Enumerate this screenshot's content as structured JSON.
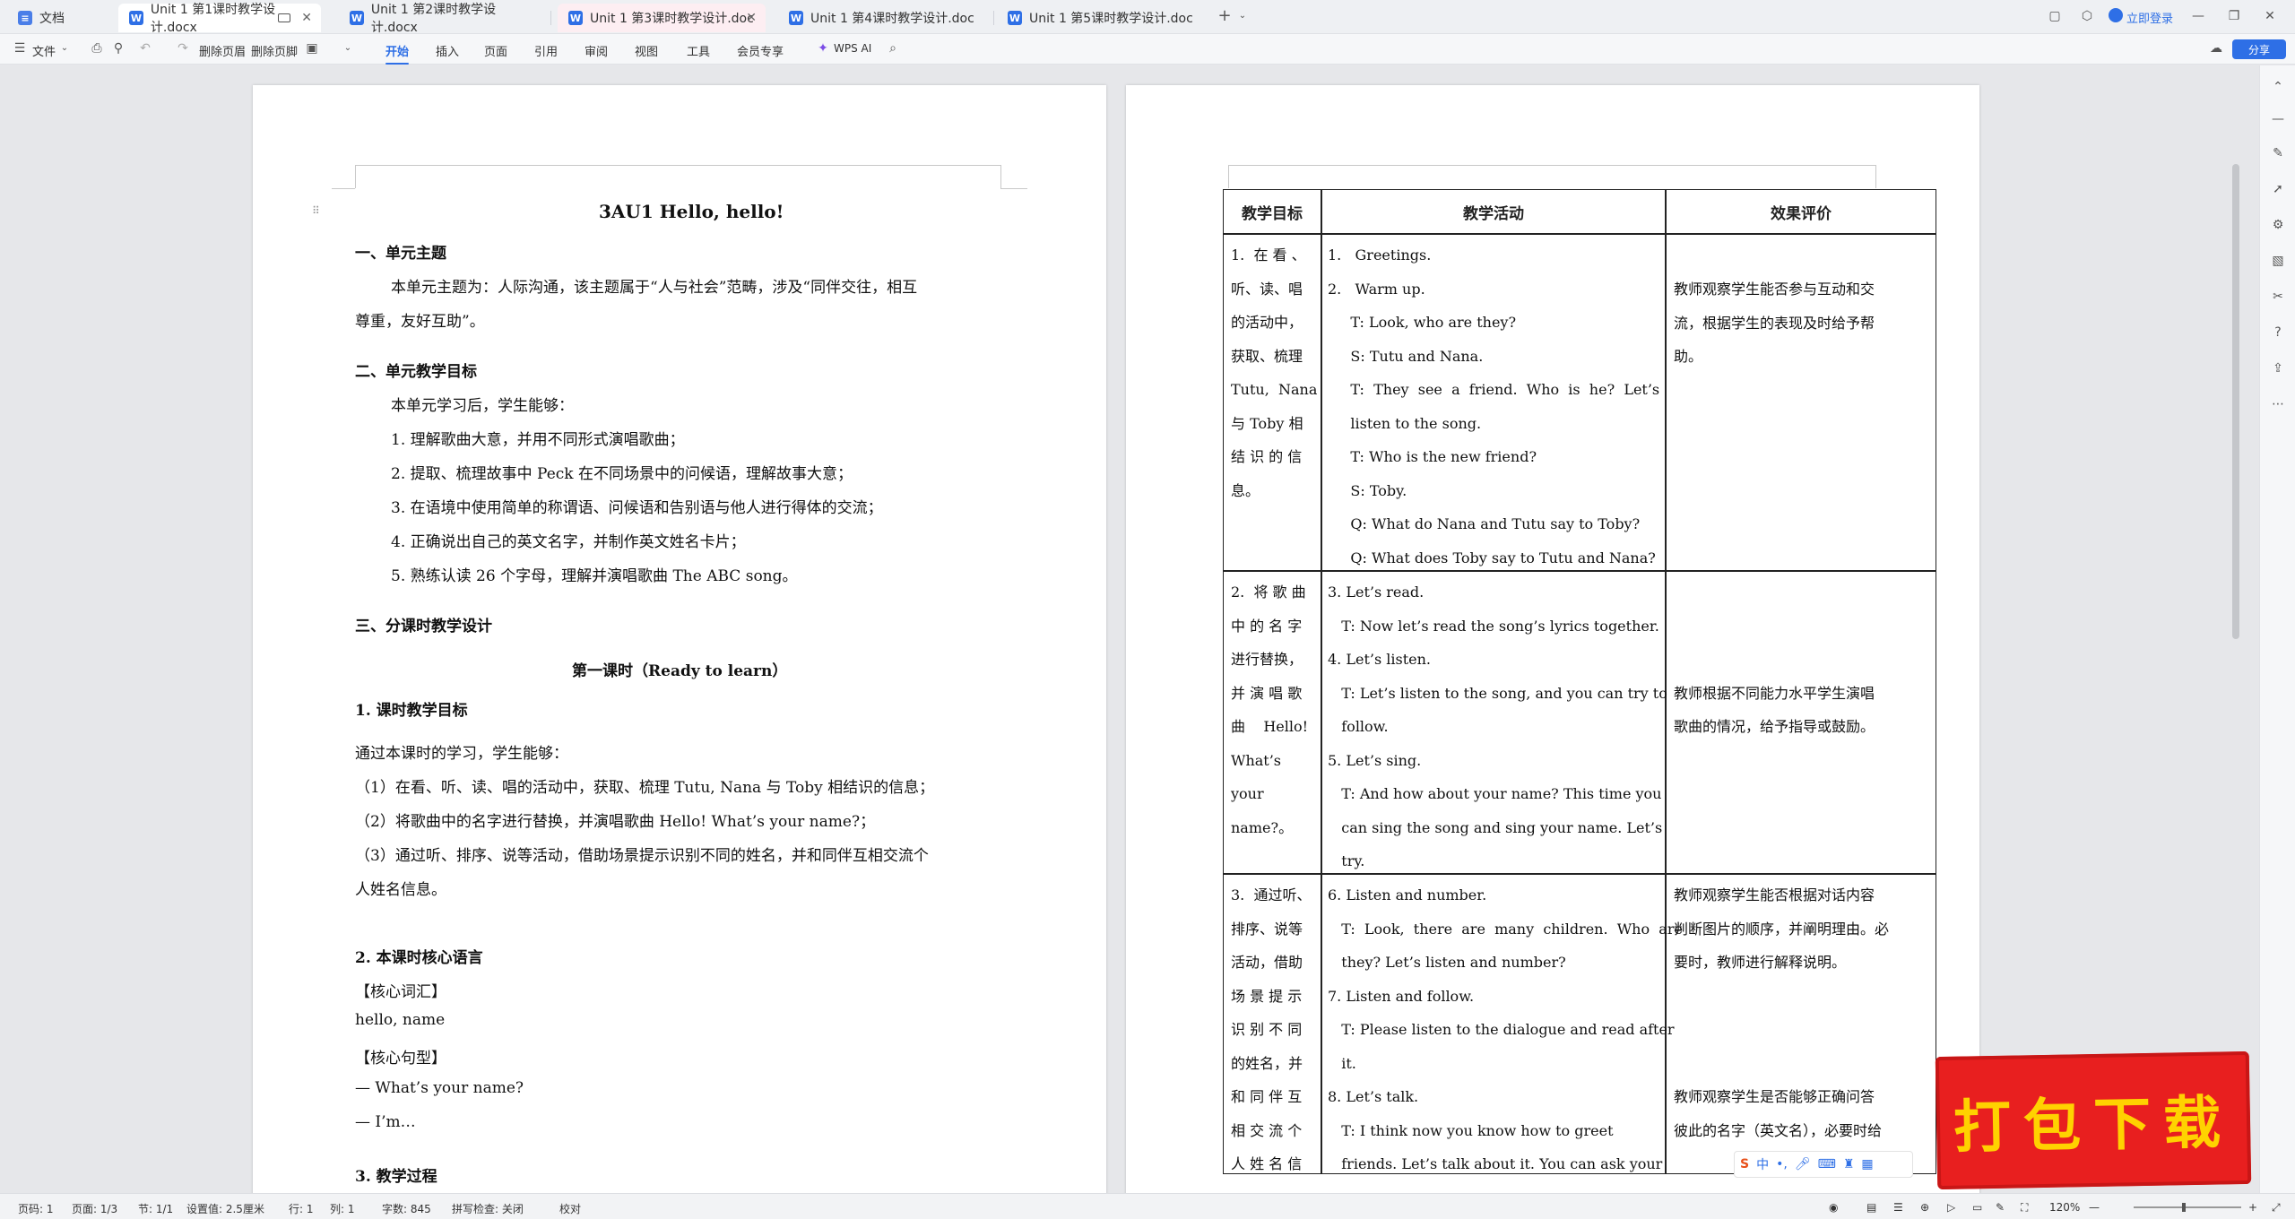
{
  "tabs": [
    {
      "label": "文档",
      "icon": "home-doc-icon"
    },
    {
      "label": "Unit 1 第1课时教学设计.docx",
      "active": true
    },
    {
      "label": "Unit 1 第2课时教学设计.docx"
    },
    {
      "label": "Unit 1 第3课时教学设计.doc"
    },
    {
      "label": "Unit 1 第4课时教学设计.doc"
    },
    {
      "label": "Unit 1 第5课时教学设计.doc"
    }
  ],
  "topright": {
    "login": "立即登录",
    "share": "分享"
  },
  "toolbar": {
    "file": "文件",
    "delete_page": "删除页眉",
    "delete_footer": "删除页脚",
    "menus": [
      "开始",
      "插入",
      "页面",
      "引用",
      "审阅",
      "视图",
      "工具",
      "会员专享"
    ],
    "wps_ai": "WPS AI"
  },
  "doc": {
    "title": "3AU1 Hello, hello!",
    "s1": "一、单元主题",
    "s1_p1": "本单元主题为：人际沟通，该主题属于“人与社会”范畴，涉及“同伴交往，相互",
    "s1_p2": "尊重，友好互助”。",
    "s2": "二、单元教学目标",
    "s2_intro": "本单元学习后，学生能够：",
    "goals": [
      "1.  理解歌曲大意，并用不同形式演唱歌曲；",
      "2.  提取、梳理故事中 Peck 在不同场景中的问候语，理解故事大意；",
      "3.  在语境中使用简单的称谓语、问候语和告别语与他人进行得体的交流；",
      "4.  正确说出自己的英文名字，并制作英文姓名卡片；",
      "5.  熟练认读 26 个字母，理解并演唱歌曲 The ABC song。"
    ],
    "s3": "三、分课时教学设计",
    "lesson1": "第一课时（Ready to learn）",
    "h1": "1.  课时教学目标",
    "h1_intro": "通过本课时的学习，学生能够：",
    "h1_items": [
      "（1）在看、听、读、唱的活动中，获取、梳理 Tutu, Nana 与 Toby 相结识的信息；",
      "（2）将歌曲中的名字进行替换，并演唱歌曲 Hello! What’s your name?；",
      "（3）通过听、排序、说等活动，借助场景提示识别不同的姓名，并和同伴互相交流个",
      "人姓名信息。"
    ],
    "h2": "2.  本课时核心语言",
    "vocab_label": "【核心词汇】",
    "vocab": "hello, name",
    "sent_label": "【核心句型】",
    "sent1": "—  What’s your name?",
    "sent2": "—  I’m…",
    "h3": "3.  教学过程"
  },
  "table": {
    "headers": [
      "教学目标",
      "教学活动",
      "效果评价"
    ],
    "rows": [
      {
        "goal": [
          "1.  在 看 、",
          "听、读、唱",
          "的活动中，",
          "获取、梳理",
          "Tutu,  Nana",
          "与 Toby 相",
          "结 识 的 信",
          "息。"
        ],
        "activities": [
          "1.   Greetings.",
          "2.   Warm up.",
          "     T: Look, who are they?",
          "     S: Tutu and Nana.",
          "     T:  They  see  a  friend.  Who  is  he?  Let’s",
          "     listen to the song.",
          "     T: Who is the new friend?",
          "     S: Toby.",
          "     Q: What do Nana and Tutu say to Toby?",
          "     Q: What does Toby say to Tutu and Nana?"
        ],
        "eval": [
          "教师观察学生能否参与互动和交",
          "流，根据学生的表现及时给予帮",
          "助。"
        ]
      },
      {
        "goal": [
          "2.  将 歌 曲",
          "中 的 名 字",
          "进行替换，",
          "并 演 唱 歌",
          "曲    Hello!",
          "What’s",
          "your",
          "name?。"
        ],
        "activities": [
          "3. Let’s read.",
          "   T: Now let’s read the song’s lyrics together.",
          "4. Let’s listen.",
          "   T: Let’s listen to the song, and you can try to",
          "   follow.",
          "5. Let’s sing.",
          "   T: And how about your name? This time you",
          "   can sing the song and sing your name. Let’s",
          "   try."
        ],
        "eval": [
          "",
          "",
          "",
          "教师根据不同能力水平学生演唱",
          "歌曲的情况，给予指导或鼓励。"
        ]
      },
      {
        "goal": [
          "3.  通过听、",
          "排序、说等",
          "活动，借助",
          "场 景 提 示",
          "识 别 不 同",
          "的姓名，并",
          "和 同 伴 互",
          "相 交 流 个",
          "人 姓 名 信"
        ],
        "activities": [
          "6. Listen and number.",
          "   T:  Look,  there  are  many  children.  Who  are",
          "   they? Let’s listen and number?",
          "7. Listen and follow.",
          "   T: Please listen to the dialogue and read after",
          "   it.",
          "8. Let’s talk.",
          "   T: I think now you know how to greet",
          "   friends. Let’s talk about it. You can ask your"
        ],
        "eval": [
          "教师观察学生能否根据对话内容",
          "判断图片的顺序，并阐明理由。必",
          "要时，教师进行解释说明。",
          "",
          "",
          "",
          "教师观察学生是否能够正确问答",
          "彼此的名字（英文名），必要时给"
        ]
      }
    ]
  },
  "status": {
    "page": "页码: 1",
    "pages": "页面: 1/3",
    "section": "节: 1/1",
    "setting": "设置值: 2.5厘米",
    "row": "行: 1",
    "col": "列: 1",
    "words": "字数: 845",
    "spell": "拼写检查: 关闭",
    "proof": "校对",
    "zoom": "120%"
  },
  "promo": "打包下载",
  "ime": "中"
}
